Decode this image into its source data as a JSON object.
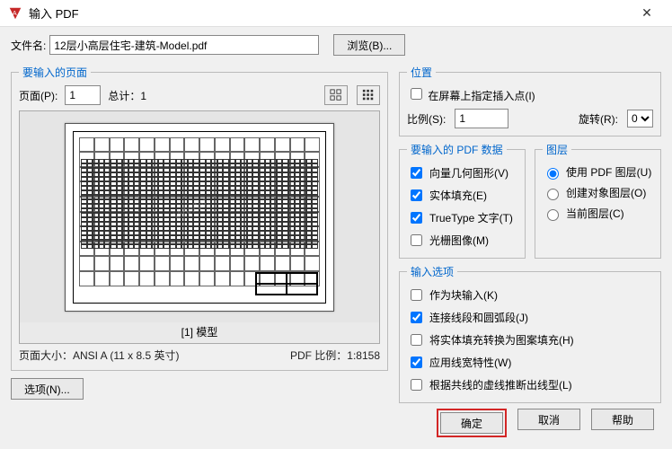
{
  "titlebar": {
    "title": "输入 PDF"
  },
  "file": {
    "label": "文件名:",
    "value": "12层小高层住宅-建筑-Model.pdf",
    "browse": "浏览(B)..."
  },
  "pages": {
    "legend": "要输入的页面",
    "page_label": "页面(P):",
    "page_value": "1",
    "total_label": "总计：",
    "total_value": "1",
    "preview_name": "[1] 模型",
    "size_label": "页面大小：ANSI A (11 x 8.5 英寸)",
    "ratio_label": "PDF 比例：1:8158"
  },
  "position": {
    "legend": "位置",
    "onscreen": "在屏幕上指定插入点(I)",
    "scale_label": "比例(S):",
    "scale_value": "1",
    "rotate_label": "旋转(R):",
    "rotate_value": "0"
  },
  "data": {
    "legend": "要输入的 PDF 数据",
    "vector": "向量几何图形(V)",
    "fill": "实体填充(E)",
    "truetype": "TrueType 文字(T)",
    "raster": "光栅图像(M)"
  },
  "layers": {
    "legend": "图层",
    "use_pdf": "使用 PDF 图层(U)",
    "create_obj": "创建对象图层(O)",
    "current": "当前图层(C)"
  },
  "import": {
    "legend": "输入选项",
    "as_block": "作为块输入(K)",
    "join": "连接线段和圆弧段(J)",
    "hatch": "将实体填充转换为图案填充(H)",
    "lineweight": "应用线宽特性(W)",
    "infer": "根据共线的虚线推断出线型(L)"
  },
  "buttons": {
    "options": "选项(N)...",
    "ok": "确定",
    "cancel": "取消",
    "help": "帮助"
  },
  "view_modes": {
    "list": "列表视图",
    "grid": "缩略视图"
  }
}
